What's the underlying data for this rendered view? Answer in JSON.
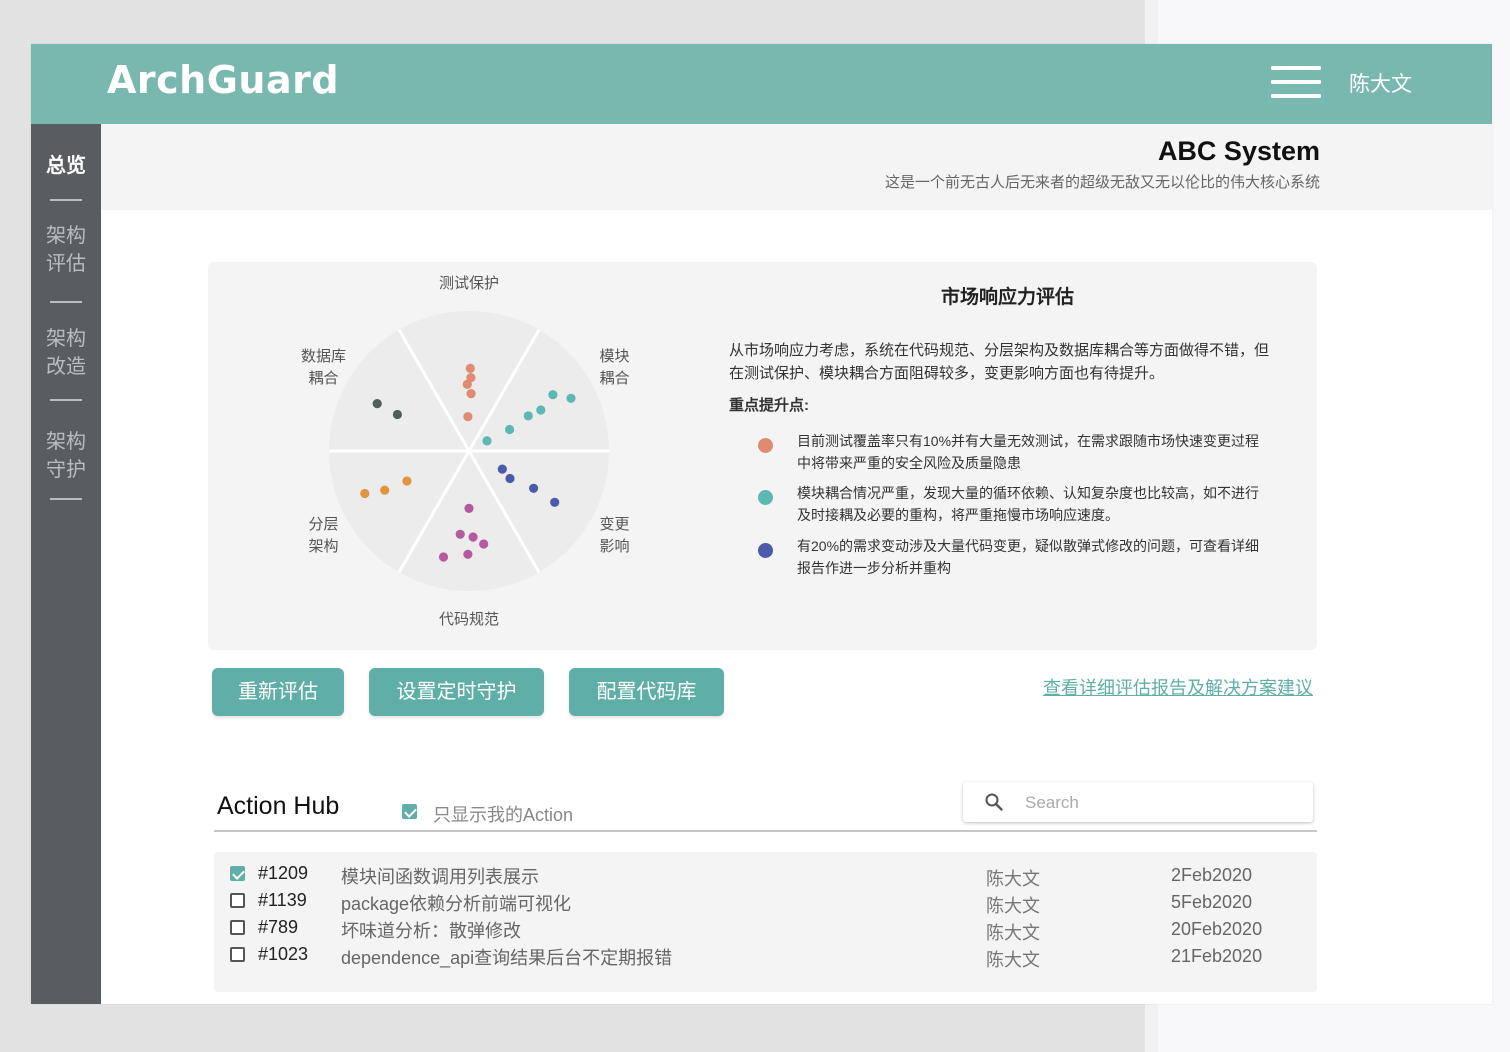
{
  "header": {
    "logo": "ArchGuard",
    "user": "陈大文"
  },
  "sidebar": {
    "items": [
      {
        "label": "总览",
        "active": true
      },
      {
        "label": "架构评估",
        "active": false
      },
      {
        "label": "架构改造",
        "active": false
      },
      {
        "label": "架构守护",
        "active": false
      }
    ]
  },
  "system": {
    "name": "ABC System",
    "description": "这是一个前无古人后无来者的超级无敌又无以伦比的伟大核心系统"
  },
  "chart_data": {
    "type": "scatter",
    "axes": [
      "测试保护",
      "模块耦合",
      "变更影响",
      "代码规范",
      "分层架构",
      "数据库耦合"
    ],
    "series": [
      {
        "axis": "测试保护",
        "color": "#e08a72",
        "points": [
          [
            0.3,
            -0.06
          ],
          [
            0.5,
            0.07
          ],
          [
            0.58,
            -0.05
          ],
          [
            0.64,
            0.05
          ],
          [
            0.72,
            0.03
          ]
        ]
      },
      {
        "axis": "模块耦合",
        "color": "#5cb8b3",
        "points": [
          [
            0.18,
            0.02
          ],
          [
            0.4,
            0.07
          ],
          [
            0.6,
            -0.02
          ],
          [
            0.72,
            0.01
          ],
          [
            0.88,
            -0.13
          ],
          [
            1.0,
            0.09
          ]
        ]
      },
      {
        "axis": "变更影响",
        "color": "#4b5aa9",
        "points": [
          [
            0.33,
            -0.05
          ],
          [
            0.43,
            0.13
          ],
          [
            0.65,
            0.0
          ],
          [
            0.87,
            0.03
          ]
        ]
      },
      {
        "axis": "代码规范",
        "color": "#b55a9e",
        "points": [
          [
            0.5,
            0.0
          ],
          [
            0.73,
            0.2
          ],
          [
            0.75,
            -0.09
          ],
          [
            0.82,
            -0.3
          ],
          [
            0.9,
            0.02
          ],
          [
            0.95,
            0.45
          ]
        ]
      },
      {
        "axis": "分层架构",
        "color": "#e09540",
        "points": [
          [
            0.6,
            0.14
          ],
          [
            0.81,
            0.17
          ],
          [
            0.98,
            0.26
          ]
        ]
      },
      {
        "axis": "数据库耦合",
        "color": "#4e6058",
        "points": [
          [
            0.7,
            -0.1
          ],
          [
            0.9,
            -0.09
          ]
        ]
      }
    ]
  },
  "evaluation": {
    "title": "市场响应力评估",
    "description": "从市场响应力考虑，系统在代码规范、分层架构及数据库耦合等方面做得不错，但在测试保护、模块耦合方面阻碍较多，变更影响方面也有待提升。",
    "focus_title": "重点提升点:",
    "points": [
      {
        "color": "#e08a72",
        "text": "目前测试覆盖率只有10%并有大量无效测试，在需求跟随市场快速变更过程中将带来严重的安全风险及质量隐患"
      },
      {
        "color": "#5cb8b3",
        "text": "模块耦合情况严重，发现大量的循环依赖、认知复杂度也比较高，如不进行及时接耦及必要的重构，将严重拖慢市场响应速度。"
      },
      {
        "color": "#4b5aa9",
        "text": "有20%的需求变动涉及大量代码变更，疑似散弹式修改的问题，可查看详细报告作进一步分析并重构"
      }
    ]
  },
  "actions": {
    "reevaluate": "重新评估",
    "schedule_guard": "设置定时守护",
    "config_repo": "配置代码库",
    "report_link": "查看详细评估报告及解决方案建议"
  },
  "hub": {
    "title": "Action Hub",
    "filter_label": "只显示我的Action",
    "filter_checked": true,
    "search_placeholder": "Search",
    "rows": [
      {
        "checked": true,
        "id": "#1209",
        "title": "模块间函数调用列表展示",
        "owner": "陈大文",
        "date": "2Feb2020"
      },
      {
        "checked": false,
        "id": "#1139",
        "title": "package依赖分析前端可视化",
        "owner": "陈大文",
        "date": "5Feb2020"
      },
      {
        "checked": false,
        "id": "#789",
        "title": "坏味道分析：散弹修改",
        "owner": "陈大文",
        "date": "20Feb2020"
      },
      {
        "checked": false,
        "id": "#1023",
        "title": "dependence_api查询结果后台不定期报错",
        "owner": "陈大文",
        "date": "21Feb2020"
      }
    ]
  }
}
